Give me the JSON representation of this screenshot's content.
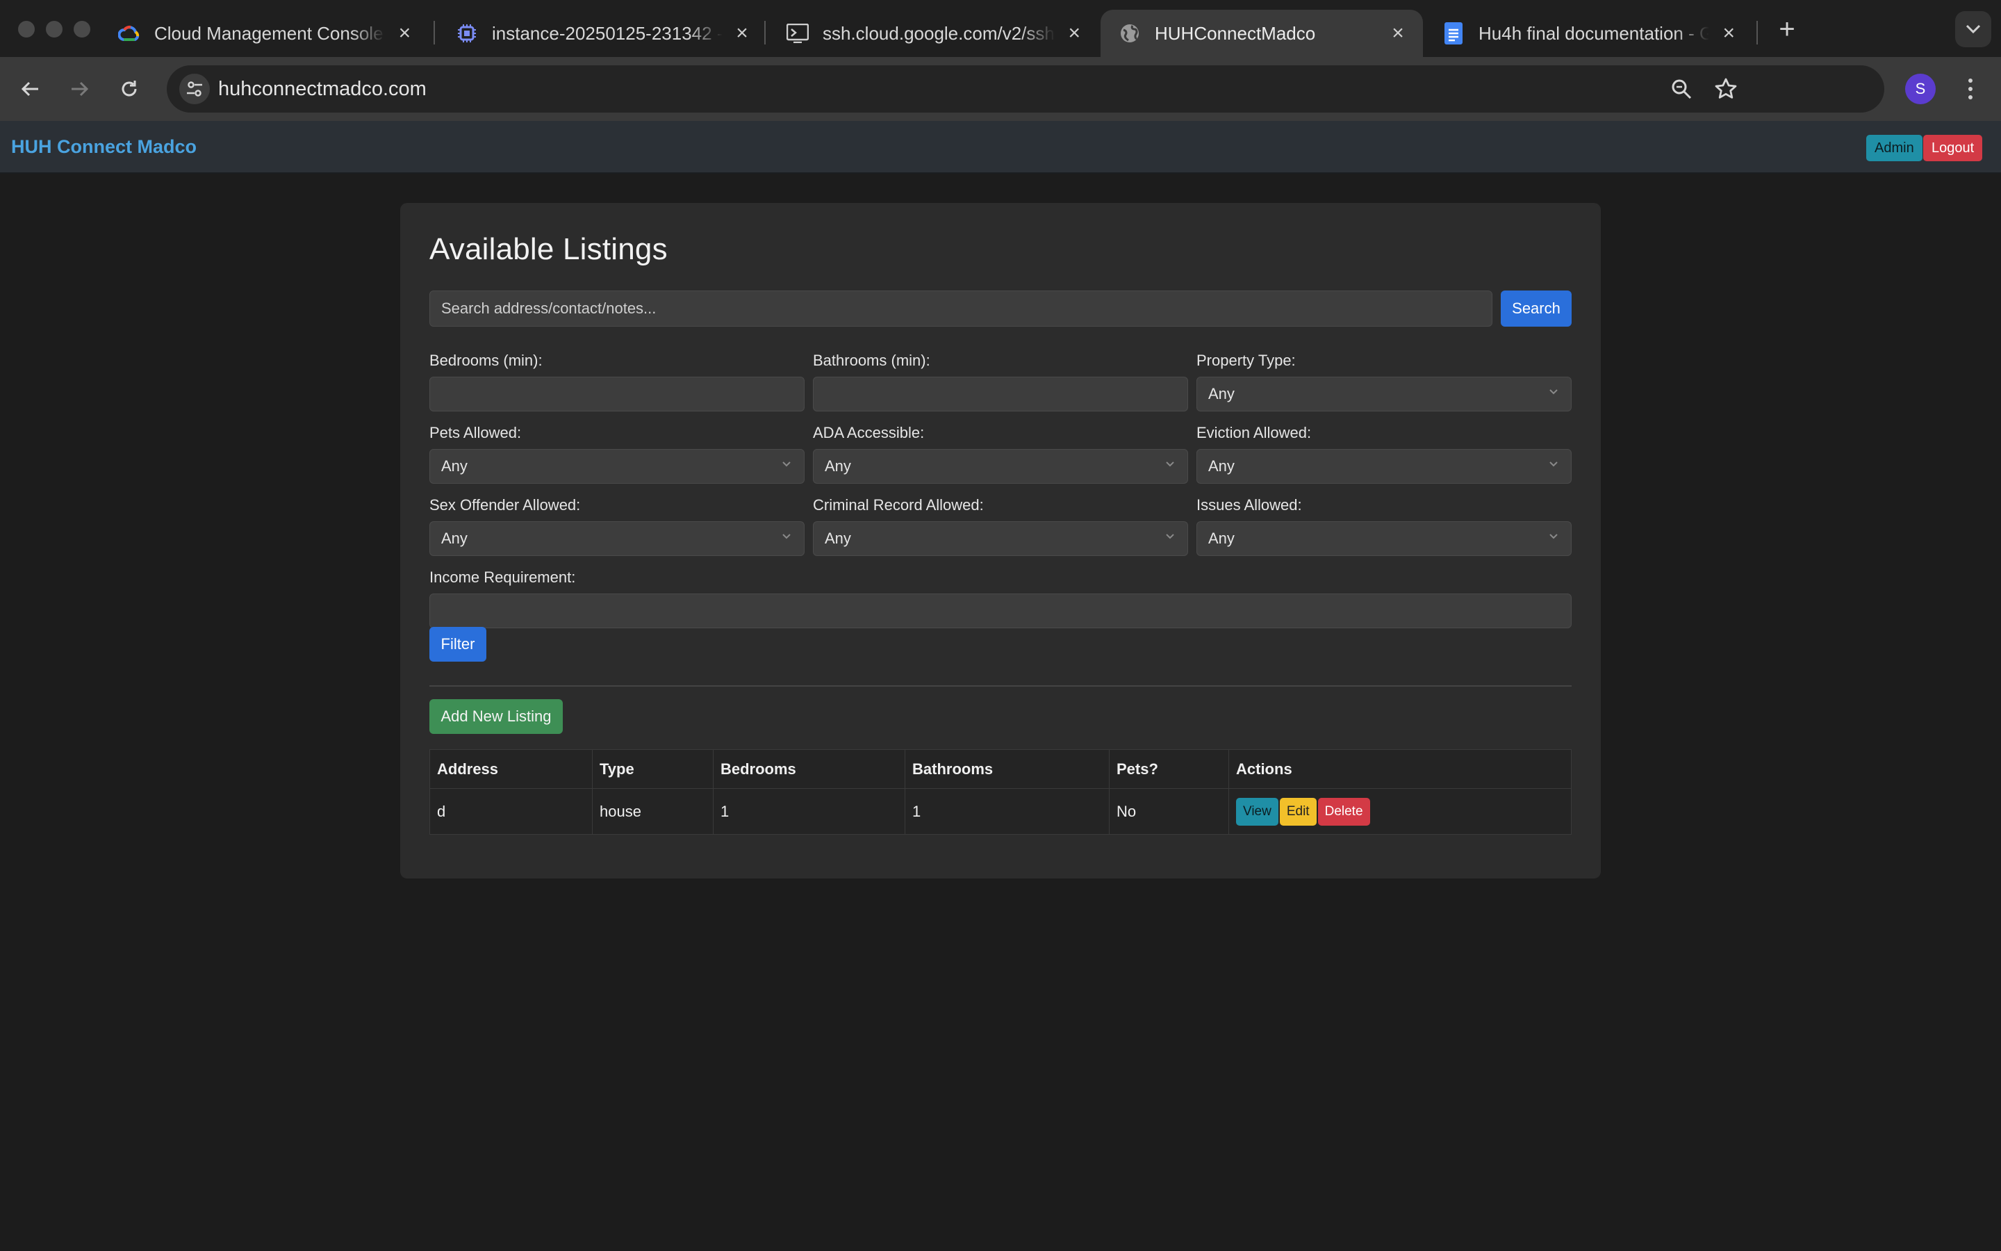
{
  "browser": {
    "tabs": [
      {
        "title": "Cloud Management Console |",
        "icon": "google-cloud-icon",
        "active": false
      },
      {
        "title": "instance-20250125-231342 -",
        "icon": "compute-chip-icon",
        "active": false
      },
      {
        "title": "ssh.cloud.google.com/v2/ssh/",
        "icon": "terminal-icon",
        "active": false
      },
      {
        "title": "HUHConnectMadco",
        "icon": "globe-icon",
        "active": true
      },
      {
        "title": "Hu4h final documentation - G",
        "icon": "google-docs-icon",
        "active": false
      }
    ],
    "url": "huhconnectmadco.com",
    "profile_initial": "S"
  },
  "app": {
    "brand": "HUH Connect Madco",
    "admin_label": "Admin",
    "logout_label": "Logout"
  },
  "main": {
    "title": "Available Listings",
    "search_placeholder": "Search address/contact/notes...",
    "search_label": "Search",
    "filters": {
      "bedrooms_label": "Bedrooms (min):",
      "bathrooms_label": "Bathrooms (min):",
      "property_type_label": "Property Type:",
      "property_type_value": "Any",
      "pets_label": "Pets Allowed:",
      "pets_value": "Any",
      "ada_label": "ADA Accessible:",
      "ada_value": "Any",
      "eviction_label": "Eviction Allowed:",
      "eviction_value": "Any",
      "sex_offender_label": "Sex Offender Allowed:",
      "sex_offender_value": "Any",
      "criminal_label": "Criminal Record Allowed:",
      "criminal_value": "Any",
      "issues_label": "Issues Allowed:",
      "issues_value": "Any",
      "income_label": "Income Requirement:"
    },
    "filter_label": "Filter",
    "add_label": "Add New Listing",
    "table": {
      "headers": [
        "Address",
        "Type",
        "Bedrooms",
        "Bathrooms",
        "Pets?",
        "Actions"
      ],
      "rows": [
        {
          "address": "d",
          "type": "house",
          "bedrooms": "1",
          "bathrooms": "1",
          "pets": "No"
        }
      ],
      "action_view": "View",
      "action_edit": "Edit",
      "action_delete": "Delete"
    }
  },
  "colors": {
    "brand": "#4aa3e0",
    "primary": "#2a6fdb",
    "success": "#3e8f55",
    "info": "#1f8fa6",
    "warning": "#f2c02a",
    "danger": "#d33a45"
  }
}
